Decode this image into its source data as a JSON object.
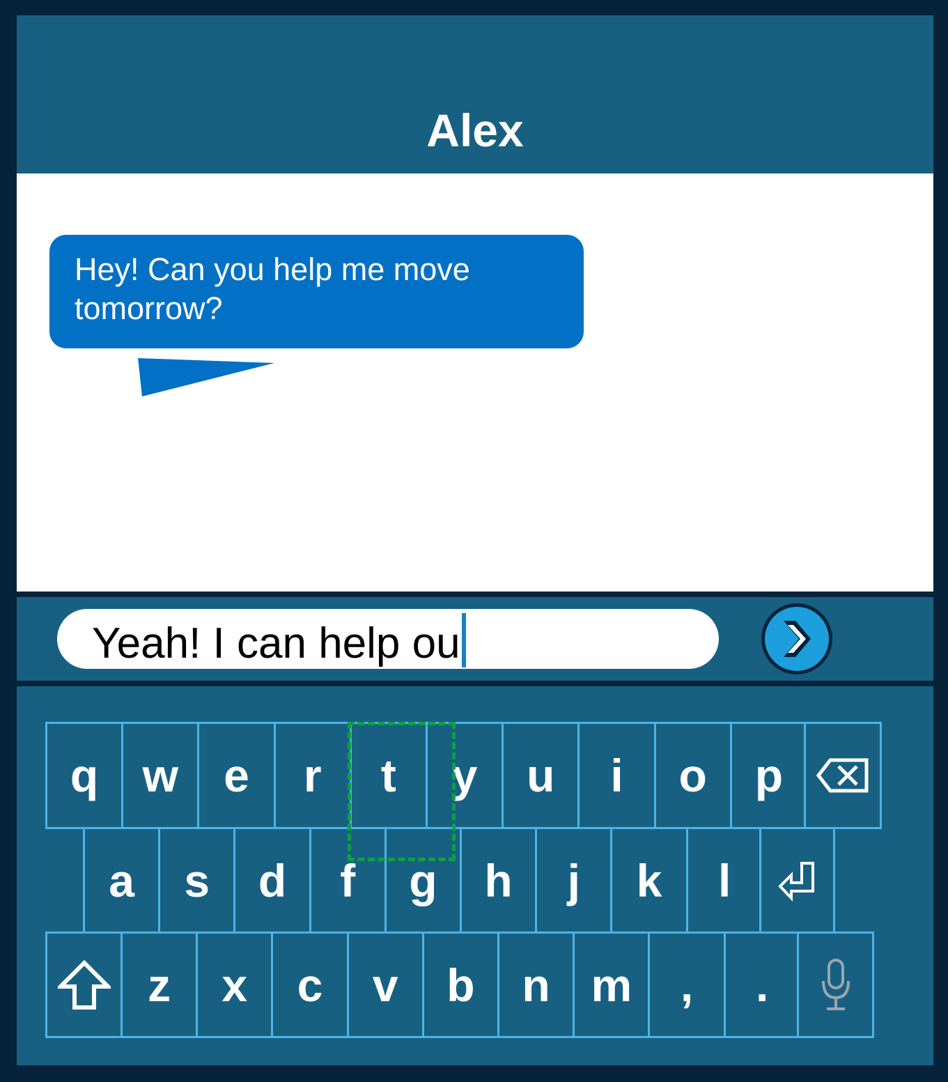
{
  "header": {
    "title": "Alex"
  },
  "chat": {
    "messages": [
      {
        "text": "Hey! Can you help me move tomorrow?"
      }
    ]
  },
  "composer": {
    "text": "Yeah! I can help ou",
    "send_icon": "chevron-right-icon"
  },
  "keyboard": {
    "row1": [
      "q",
      "w",
      "e",
      "r",
      "t",
      "y",
      "u",
      "i",
      "o",
      "p"
    ],
    "row2": [
      "a",
      "s",
      "d",
      "f",
      "g",
      "h",
      "j",
      "k",
      "l"
    ],
    "row3": [
      "z",
      "x",
      "c",
      "v",
      "b",
      "n",
      "m",
      ",",
      "."
    ],
    "special_icons": {
      "backspace": "backspace-icon",
      "enter": "enter-icon",
      "shift": "shift-icon",
      "mic": "microphone-icon"
    },
    "highlight_keys": [
      "t",
      "y",
      "f",
      "g"
    ],
    "highlight_color": "#0f9e48"
  },
  "colors": {
    "header_bg": "#186082",
    "bubble_bg": "#0271c5",
    "key_border": "#4db3e6",
    "send_bg": "#1c9fdc",
    "frame": "#06233a"
  }
}
